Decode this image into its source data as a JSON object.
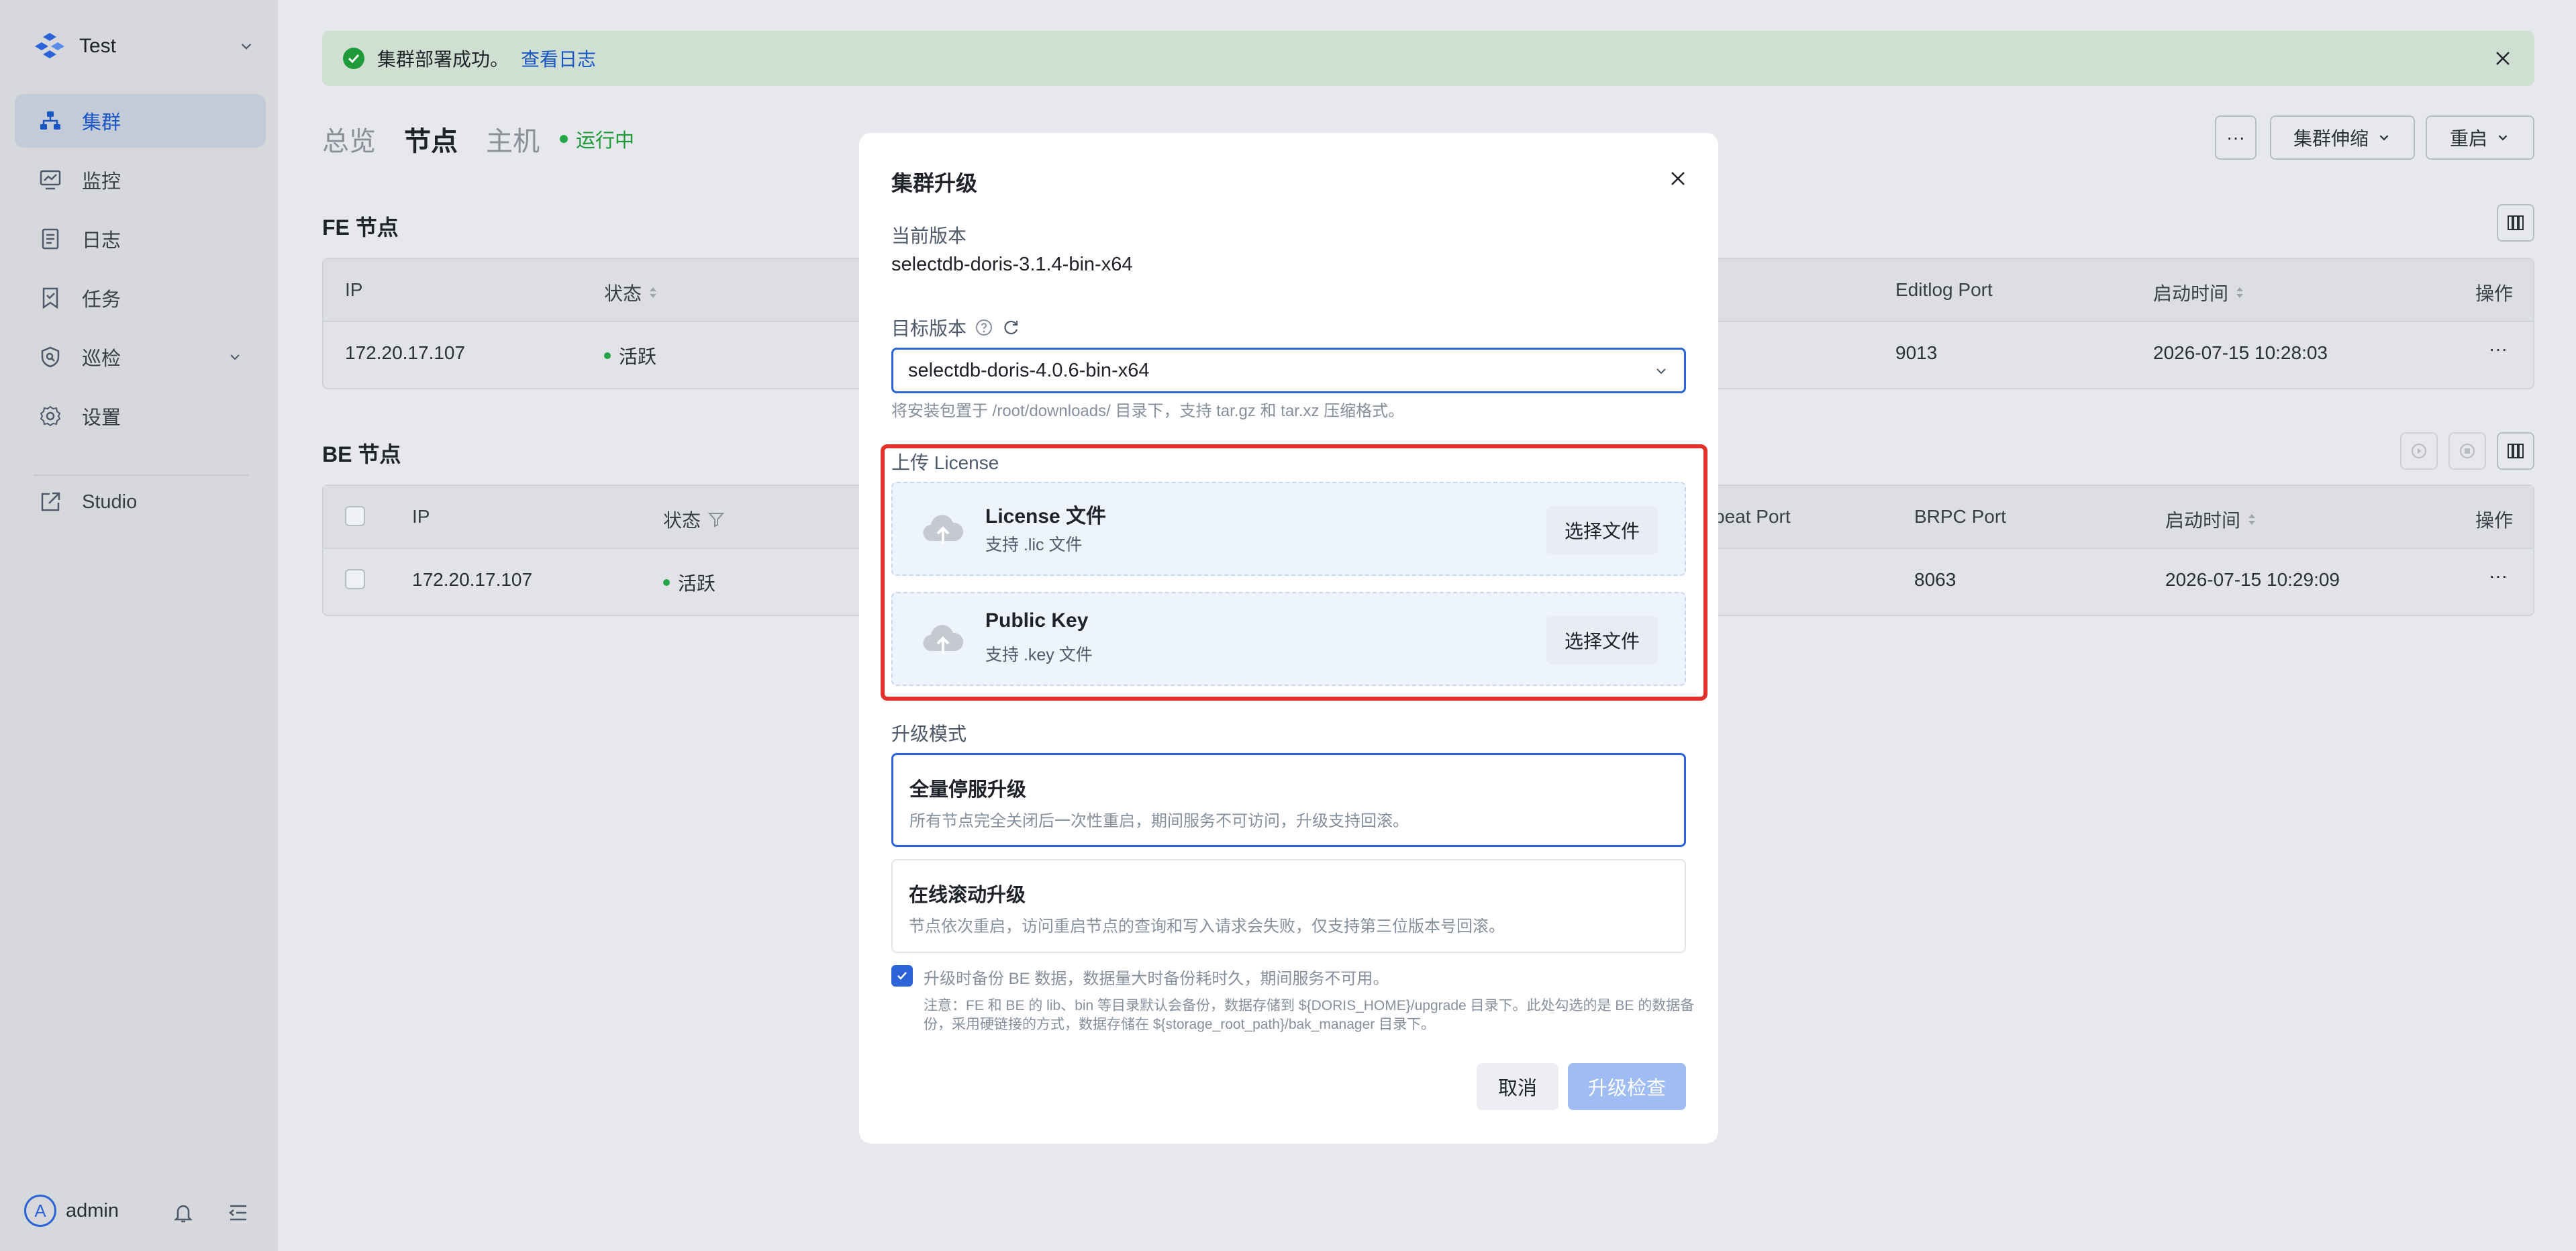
{
  "sidebar": {
    "org_name": "Test",
    "nav": [
      {
        "label": "集群",
        "icon": "cluster-icon",
        "active": true
      },
      {
        "label": "监控",
        "icon": "monitor-icon"
      },
      {
        "label": "日志",
        "icon": "log-icon"
      },
      {
        "label": "任务",
        "icon": "task-icon"
      },
      {
        "label": "巡检",
        "icon": "inspection-icon"
      },
      {
        "label": "设置",
        "icon": "settings-icon"
      },
      {
        "label": "Studio",
        "icon": "external-link-icon"
      }
    ],
    "user": {
      "avatar_letter": "A",
      "name": "admin"
    }
  },
  "alert": {
    "message": "集群部署成功。",
    "link": "查看日志"
  },
  "tabs": [
    "总览",
    "节点",
    "主机"
  ],
  "status": "运行中",
  "toolbar": {
    "more": "···",
    "scale": "集群伸缩",
    "restart": "重启"
  },
  "fe": {
    "title": "FE 节点",
    "headers": {
      "ip": "IP",
      "status": "状态",
      "editlog": "Editlog Port",
      "start": "启动时间",
      "ops": "操作"
    },
    "row": {
      "ip": "172.20.17.107",
      "status": "活跃",
      "editlog": "9013",
      "start": "2026-07-15 10:28:03",
      "ops": "···"
    }
  },
  "be": {
    "title": "BE 节点",
    "headers": {
      "ip": "IP",
      "status": "状态",
      "heartbeat": "beat Port",
      "brpc": "BRPC Port",
      "start": "启动时间",
      "ops": "操作"
    },
    "row": {
      "ip": "172.20.17.107",
      "status": "活跃",
      "brpc": "8063",
      "start": "2026-07-15 10:29:09",
      "ops": "···"
    }
  },
  "modal": {
    "title": "集群升级",
    "current_label": "当前版本",
    "current_value": "selectdb-doris-3.1.4-bin-x64",
    "target_label": "目标版本",
    "target_value": "selectdb-doris-4.0.6-bin-x64",
    "helper": "将安装包置于 /root/downloads/ 目录下，支持 tar.gz 和 tar.xz 压缩格式。",
    "upload_label": "上传 License",
    "license": {
      "title": "License 文件",
      "sub": "支持 .lic 文件",
      "button": "选择文件"
    },
    "pubkey": {
      "title": "Public Key",
      "sub": "支持 .key 文件",
      "button": "选择文件"
    },
    "mode_label": "升级模式",
    "mode_full": {
      "title": "全量停服升级",
      "desc": "所有节点完全关闭后一次性重启，期间服务不可访问，升级支持回滚。"
    },
    "mode_rolling": {
      "title": "在线滚动升级",
      "desc": "节点依次重启，访问重启节点的查询和写入请求会失败，仅支持第三位版本号回滚。"
    },
    "backup": "升级时备份 BE 数据，数据量大时备份耗时久，期间服务不可用。",
    "note_line1": "注意：FE 和 BE 的 lib、bin 等目录默认会备份，数据存储到 ${DORIS_HOME}/upgrade 目录下。此处勾选的是 BE 的数据备",
    "note_line2": "份，采用硬链接的方式，数据存储在 ${storage_root_path}/bak_manager 目录下。",
    "cancel": "取消",
    "confirm": "升级检查"
  }
}
